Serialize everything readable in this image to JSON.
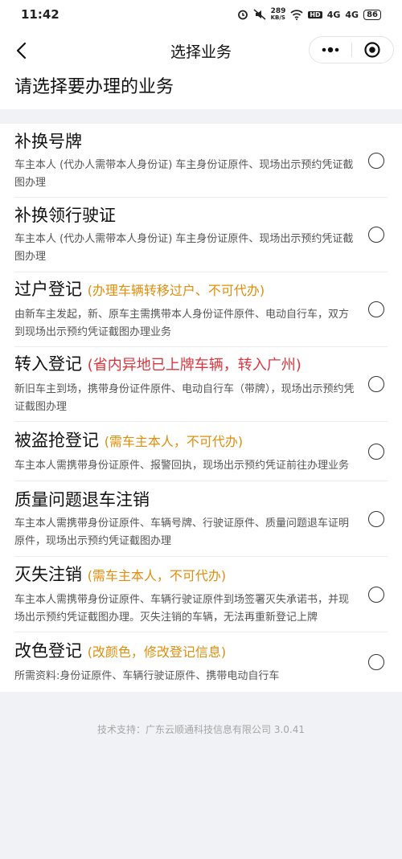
{
  "status_bar": {
    "time": "11:42",
    "network_speed": "289",
    "network_speed_unit": "KB/S",
    "hd_badge": "HD",
    "signal_1": "4G",
    "signal_2": "4G",
    "battery": "86"
  },
  "nav": {
    "title": "选择业务",
    "back_icon": "chevron-left-icon",
    "more_icon": "more-dots-icon",
    "close_icon": "target-circle-icon"
  },
  "heading": "请选择要办理的业务",
  "items": [
    {
      "title": "补换号牌",
      "note": "",
      "desc": "车主本人 (代办人需带本人身份证) 车主身份证原件、现场出示预约凭证截图办理"
    },
    {
      "title": "补换领行驶证",
      "note": "",
      "desc": "车主本人 (代办人需带本人身份证) 车主身份证原件、现场出示预约凭证截图办理"
    },
    {
      "title": "过户登记",
      "note": "(办理车辆转移过户、不可代办)",
      "desc": "由新车主发起，新、原车主需携带本人身份证件原件、电动自行车，双方到现场出示预约凭证截图办理业务"
    },
    {
      "title": "转入登记",
      "note": "(省内异地已上牌车辆，转入广州)",
      "desc": "新旧车主到场，携带身份证件原件、电动自行车（带牌），现场出示预约凭证截图办理"
    },
    {
      "title": "被盗抢登记",
      "note": "(需车主本人，不可代办)",
      "desc": "车主本人需携带身份证原件、报警回执，现场出示预约凭证前往办理业务"
    },
    {
      "title": "质量问题退车注销",
      "note": "",
      "desc": "车主本人需携带身份证原件、车辆号牌、行驶证原件、质量问题退车证明原件，现场出示预约凭证截图办理"
    },
    {
      "title": "灭失注销",
      "note": "(需车主本人，不可代办)",
      "desc": "车主本人需携带身份证原件、车辆行驶证原件到场签署灭失承诺书，并现场出示预约凭证截图办理。灭失注销的车辆，无法再重新登记上牌"
    },
    {
      "title": "改色登记",
      "note": "(改颜色，修改登记信息)",
      "desc": "所需资料:身份证原件、车辆行驶证原件、携带电动自行车"
    }
  ],
  "footer": "技术支持：广东云顺通科技信息有限公司 3.0.41",
  "colors": {
    "note_orange": "#e08e0b",
    "note_red": "#d9363e",
    "background": "#f1f2f5"
  }
}
